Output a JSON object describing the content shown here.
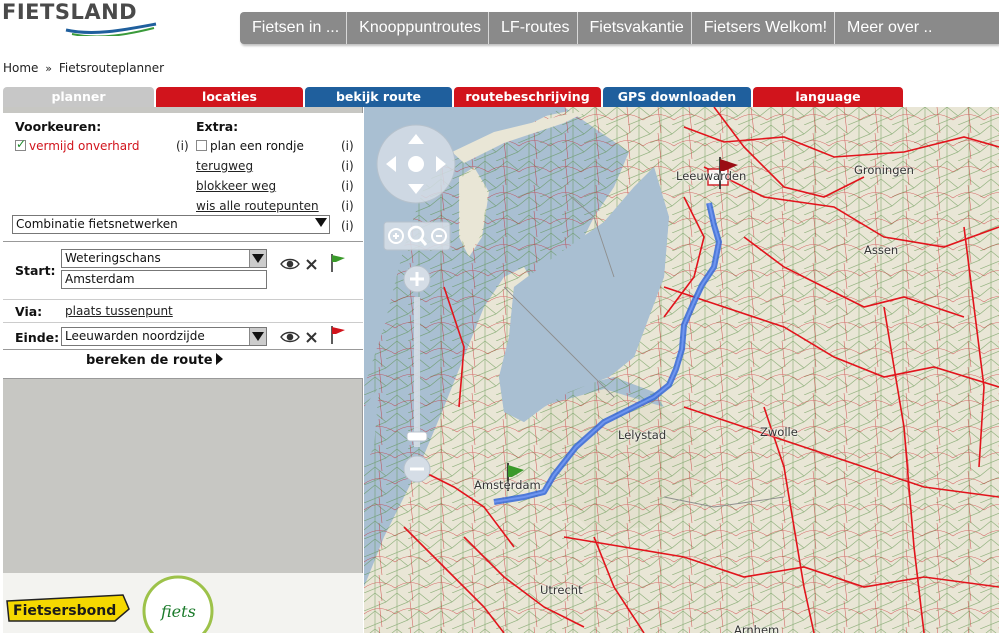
{
  "logo": {
    "text": "FIETSLAND"
  },
  "topnav": [
    "Fietsen in ...",
    "Knooppuntroutes",
    "LF-routes",
    "Fietsvakantie",
    "Fietsers Welkom!",
    "Meer over .."
  ],
  "breadcrumb": {
    "home": "Home",
    "separator": "»",
    "current": "Fietsrouteplanner"
  },
  "tabs": [
    {
      "label": "planner",
      "color": "#c7c7c7"
    },
    {
      "label": "locaties",
      "color": "#d1141c"
    },
    {
      "label": "bekijk route",
      "color": "#1f5f9d"
    },
    {
      "label": "routebeschrijving",
      "color": "#d1141c"
    },
    {
      "label": "GPS downloaden",
      "color": "#1f5f9d"
    },
    {
      "label": "language",
      "color": "#d1141c"
    }
  ],
  "planner": {
    "voorkeuren_label": "Voorkeuren:",
    "vermijd_onverhard": "vermijd onverhard",
    "extra_label": "Extra:",
    "plan_rondje": "plan een rondje",
    "terugweg": "terugweg",
    "blokkeer_weg": "blokkeer weg",
    "wis_routepunten": "wis alle routepunten",
    "info": "(i)",
    "network_select": "Combinatie fietsnetwerken",
    "start_label": "Start:",
    "start_street": "Weteringschans",
    "start_city": "Amsterdam",
    "via_label": "Via:",
    "via_link": "plaats tussenpunt",
    "einde_label": "Einde:",
    "einde_value": "Leeuwarden noordzijde",
    "bereken": "bereken de route"
  },
  "map": {
    "places": {
      "leeuwarden": "Leeuwarden",
      "groningen": "Groningen",
      "assen": "Assen",
      "lelystad": "Lelystad",
      "zwolle": "Zwolle",
      "amsterdam": "Amsterdam",
      "utrecht": "Utrecht",
      "arnhem": "Arnhem"
    },
    "colors": {
      "route": "#3466d8",
      "network": "#e2141c",
      "water": "#a9bfd2",
      "land": "#e9e6d6",
      "green": "#2e7d32"
    }
  },
  "logos": {
    "fietsersbond": "Fietsersbond",
    "fiets": "fiets"
  }
}
